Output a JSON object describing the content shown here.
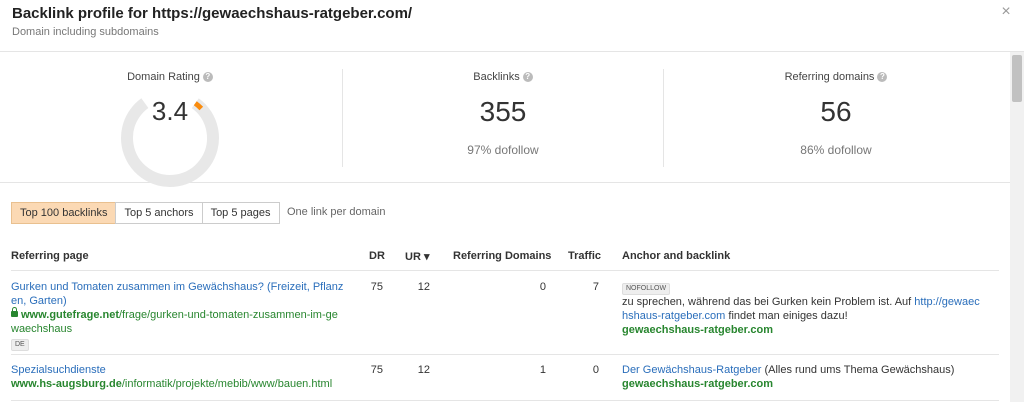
{
  "header": {
    "title": "Backlink profile for https://gewaechshaus-ratgeber.com/",
    "subtitle": "Domain including subdomains",
    "close_icon": "×"
  },
  "metrics": {
    "domain_rating": {
      "label": "Domain Rating",
      "value": "3.4",
      "gauge_fraction": 0.034,
      "gauge_color": "#f98b0d"
    },
    "backlinks": {
      "label": "Backlinks",
      "value": "355",
      "sub": "97% dofollow"
    },
    "referring_domains": {
      "label": "Referring domains",
      "value": "56",
      "sub": "86% dofollow"
    },
    "help_icon": "?"
  },
  "tabs": {
    "items": [
      {
        "label": "Top 100 backlinks",
        "active": true
      },
      {
        "label": "Top 5 anchors",
        "active": false
      },
      {
        "label": "Top 5 pages",
        "active": false
      }
    ],
    "note": "One link per domain"
  },
  "table": {
    "headers": {
      "referring_page": "Referring page",
      "dr": "DR",
      "ur": "UR",
      "ur_sort_icon": "▾",
      "referring_domains": "Referring Domains",
      "traffic": "Traffic",
      "anchor": "Anchor and backlink"
    },
    "rows": [
      {
        "title": "Gurken und Tomaten zusammen im Gewächshaus? (Freizeit, Pflanz",
        "title2": "en, Garten)",
        "url_domain": "www.gutefrage.net",
        "url_path": "/frage/gurken-und-tomaten-zusammen-im-ge",
        "url_path2": "waechshaus",
        "lang": "DE",
        "dr": "75",
        "ur": "12",
        "ref_domains": "0",
        "traffic": "7",
        "nofollow": "NOFOLLOW",
        "anchor_text1": "zu sprechen, während das bei Gurken kein Problem ist. Auf ",
        "anchor_link1": "http://gewaec",
        "anchor_link2": "hshaus-ratgeber.com",
        "anchor_text2": " findet man einiges dazu!",
        "backlink": "gewaechshaus-ratgeber.com"
      },
      {
        "title": "Spezialsuchdienste",
        "url_domain": "www.hs-augsburg.de",
        "url_path": "/informatik/projekte/mebib/www/bauen.html",
        "dr": "75",
        "ur": "12",
        "ref_domains": "1",
        "traffic": "0",
        "anchor_link": "Der Gewächshaus-Ratgeber",
        "anchor_text": " (Alles rund ums Thema Gewächshaus)",
        "backlink": "gewaechshaus-ratgeber.com"
      }
    ]
  }
}
